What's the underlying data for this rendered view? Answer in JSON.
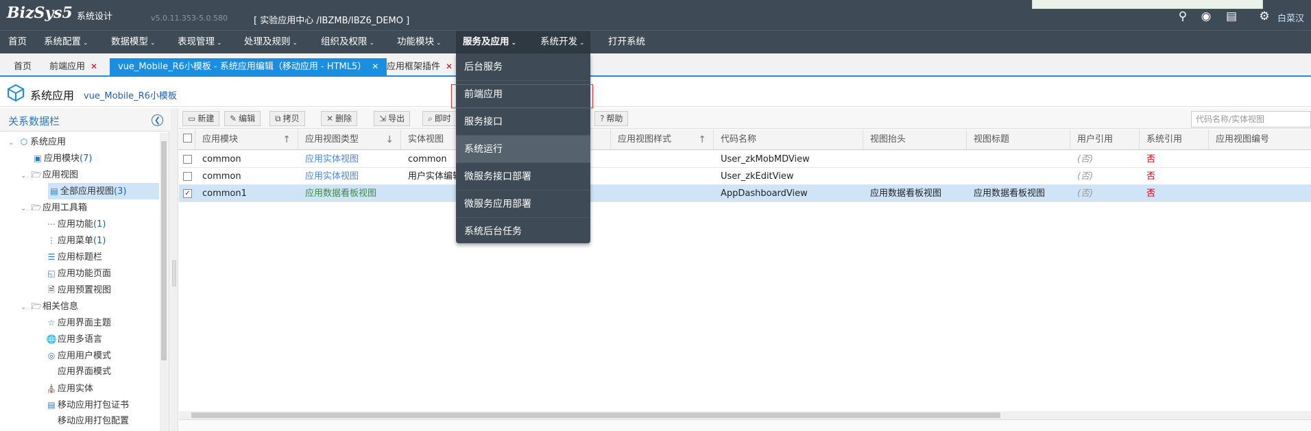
{
  "header": {
    "logo": "BizSys5",
    "logo_subtitle": "系统设计",
    "version": "v5.0.11.353-5.0.580",
    "app_context": "[ 实验应用中心 /IBZMB/IBZ6_DEMO ]",
    "username": "白菜汉",
    "icons": [
      "search-icon",
      "github-icon",
      "chat-icon",
      "user-settings-icon"
    ]
  },
  "nav": {
    "items": [
      "首页",
      "系统配置",
      "数据模型",
      "表现管理",
      "处理及规则",
      "组织及权限",
      "功能模块",
      "服务及应用",
      "系统开发",
      "打开系统"
    ],
    "active": "服务及应用"
  },
  "dropdown": {
    "items": [
      "后台服务",
      "前端应用",
      "服务接口",
      "系统运行",
      "微服务接口部署",
      "微服务应用部署",
      "系统后台任务"
    ],
    "highlighted": "前端应用"
  },
  "tabs": [
    {
      "label": "首页",
      "closable": false
    },
    {
      "label": "前端应用",
      "closable": true
    },
    {
      "label": "vue_Mobile_R6小模板 - 系统应用编辑（移动应用 - HTML5）",
      "closable": true,
      "active": true
    },
    {
      "label": "应用框架插件",
      "closable": true
    }
  ],
  "page": {
    "title": "系统应用",
    "subtitle": "vue_Mobile_R6小模板"
  },
  "sidebar": {
    "title": "关系数据栏",
    "tree": [
      {
        "label": "系统应用",
        "level": 0,
        "icon": "cube-icon",
        "toggle": "open"
      },
      {
        "label": "应用模块",
        "count": "(7)",
        "level": 1,
        "icon": "module-icon"
      },
      {
        "label": "应用视图",
        "level": 1,
        "icon": "folder-icon",
        "toggle": "open"
      },
      {
        "label": "全部应用视图",
        "count": "(3)",
        "level": 2,
        "icon": "views-icon",
        "selected": true
      },
      {
        "label": "应用工具箱",
        "level": 1,
        "icon": "folder-icon",
        "toggle": "open"
      },
      {
        "label": "应用功能",
        "count": "(1)",
        "level": 2,
        "icon": "dots-icon"
      },
      {
        "label": "应用菜单",
        "count": "(1)",
        "level": 2,
        "icon": "menu-icon"
      },
      {
        "label": "应用标题栏",
        "level": 2,
        "icon": "list-icon"
      },
      {
        "label": "应用功能页面",
        "level": 2,
        "icon": "page-icon"
      },
      {
        "label": "应用预置视图",
        "level": 2,
        "icon": "document-icon"
      },
      {
        "label": "相关信息",
        "level": 1,
        "icon": "folder-icon",
        "toggle": "open"
      },
      {
        "label": "应用界面主题",
        "level": 2,
        "icon": "theme-icon"
      },
      {
        "label": "应用多语言",
        "level": 2,
        "icon": "globe-icon"
      },
      {
        "label": "应用用户模式",
        "level": 2,
        "icon": "circle-icon"
      },
      {
        "label": "应用界面模式",
        "level": 2,
        "icon": ""
      },
      {
        "label": "应用实体",
        "level": 2,
        "icon": "entity-icon"
      },
      {
        "label": "移动应用打包证书",
        "level": 2,
        "icon": "certificate-icon"
      },
      {
        "label": "移动应用打包配置",
        "level": 2,
        "icon": ""
      }
    ]
  },
  "toolbar": {
    "buttons": [
      {
        "label": "新建",
        "icon": "new-icon",
        "glyph": "▭"
      },
      {
        "label": "编辑",
        "icon": "edit-icon",
        "glyph": "✎"
      },
      {
        "label": "拷贝",
        "icon": "copy-icon",
        "glyph": "⧉"
      },
      {
        "label": "删除",
        "icon": "delete-icon",
        "glyph": "✕"
      },
      {
        "label": "导出",
        "icon": "export-icon",
        "glyph": "⇲"
      },
      {
        "label": "即时",
        "icon": "search-icon",
        "glyph": "⌕"
      },
      {
        "label": "帮助",
        "icon": "help-icon",
        "glyph": "?"
      }
    ],
    "search_placeholder": "代码名称/实体视图"
  },
  "grid": {
    "columns": [
      {
        "label": "应用模块",
        "sort": "↑"
      },
      {
        "label": "应用视图类型",
        "sort": "↓"
      },
      {
        "label": "实体视图",
        "sort": ""
      },
      {
        "label": "",
        "sort": ""
      },
      {
        "label": "应用视图样式",
        "sort": "↑"
      },
      {
        "label": "代码名称",
        "sort": ""
      },
      {
        "label": "视图抬头",
        "sort": ""
      },
      {
        "label": "视图标题",
        "sort": ""
      },
      {
        "label": "用户引用",
        "sort": ""
      },
      {
        "label": "系统引用",
        "sort": ""
      },
      {
        "label": "应用视图编号",
        "sort": ""
      }
    ],
    "rows": [
      {
        "checked": false,
        "module": "common",
        "view_type": "应用实体视图",
        "entity_view": "common",
        "style": "",
        "code": "User_zkMobMDView",
        "caption": "",
        "title": "",
        "user_ref": "(否)",
        "sys_ref": "否",
        "selected": false
      },
      {
        "checked": false,
        "module": "common",
        "view_type": "应用实体视图",
        "entity_view": "用户实体编辑",
        "style": "",
        "code": "User_zkEditView",
        "caption": "",
        "title": "",
        "user_ref": "(否)",
        "sys_ref": "否",
        "selected": false
      },
      {
        "checked": true,
        "module": "common1",
        "view_type": "应用数据看板视图",
        "entity_view": "",
        "style": "",
        "code": "AppDashboardView",
        "caption": "应用数据看板视图",
        "title": "应用数据看板视图",
        "user_ref": "(否)",
        "sys_ref": "否",
        "selected": true
      }
    ]
  }
}
